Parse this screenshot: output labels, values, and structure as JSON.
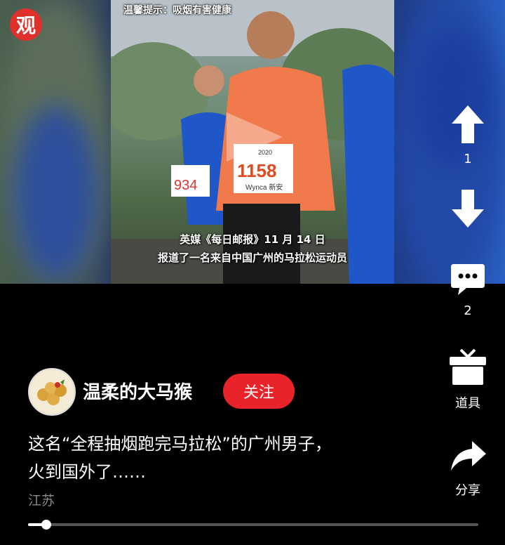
{
  "logo": {
    "text": "观"
  },
  "video": {
    "warning": "温馨提示：吸烟有害健康",
    "bib_number": "1158",
    "bib_sponsor": "Wynca 新安",
    "bib_year": "2020",
    "runner_bib_partial": "934",
    "subtitle_line1": "英媒《每日邮报》11 月 14 日",
    "subtitle_line2": "报道了一名来自中国广州的马拉松运动员"
  },
  "actions": {
    "upvote": {
      "icon": "arrow-up-icon",
      "count": "1"
    },
    "downvote": {
      "icon": "arrow-down-icon"
    },
    "comment": {
      "icon": "comment-icon",
      "count": "2"
    },
    "props": {
      "icon": "gift-box-icon",
      "label": "道具"
    },
    "share": {
      "icon": "share-icon",
      "label": "分享"
    }
  },
  "author": {
    "name": "温柔的大马猴",
    "follow_label": "关注"
  },
  "post": {
    "description_line1": "这名“全程抽烟跑完马拉松”的广州男子，",
    "description_line2": "火到国外了……",
    "location": "江苏"
  },
  "playback": {
    "progress": 0.04
  },
  "colors": {
    "accent": "#e8232a",
    "background": "#000000"
  }
}
